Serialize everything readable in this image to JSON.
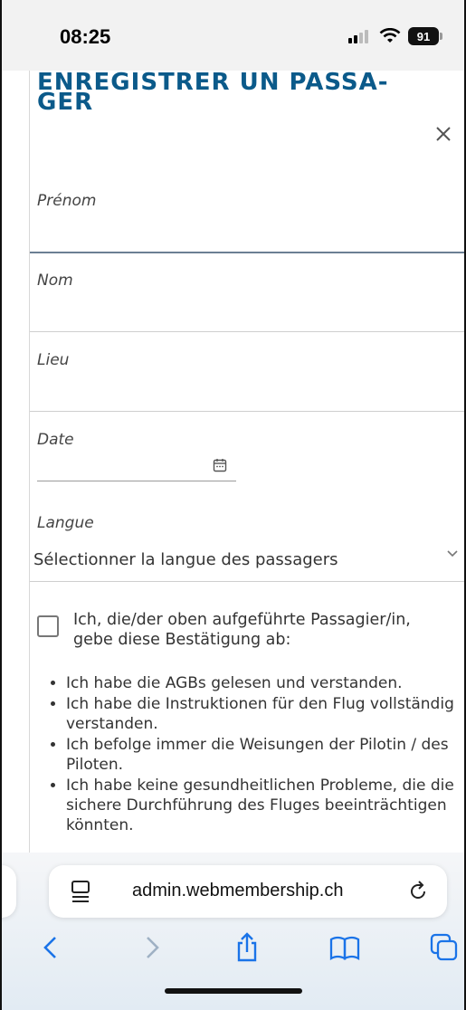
{
  "status_bar": {
    "time": "08:25",
    "battery": "91",
    "icons": [
      "signal-icon",
      "wifi-icon",
      "battery-icon"
    ]
  },
  "form": {
    "title": "ENREGISTRER UN PASSA-GER",
    "close_icon": "close-icon",
    "fields": {
      "first_name": {
        "label": "Prénom",
        "value": ""
      },
      "last_name": {
        "label": "Nom",
        "value": ""
      },
      "place": {
        "label": "Lieu",
        "value": ""
      },
      "date": {
        "label": "Date",
        "value": ""
      },
      "language": {
        "label": "Langue",
        "selected": "Sélectionner la langue des passagers"
      }
    },
    "consent": {
      "checked": false,
      "text": "Ich, die/der oben aufgeführte Passagier/in, gebe diese Bestätigung ab:",
      "bullets": [
        "Ich habe die AGBs gelesen und verstanden.",
        "Ich habe die Instruktionen für den Flug vollständig verstanden.",
        "Ich befolge immer die Weisungen der Pilotin / des Piloten.",
        "Ich habe keine gesundheitlichen Probleme, die die sichere Durchführung des Fluges beeinträchtigen könnten."
      ]
    }
  },
  "browser": {
    "url": "admin.webmembership.ch",
    "buttons": [
      "back-icon",
      "forward-icon",
      "share-icon",
      "bookmarks-icon",
      "tabs-icon"
    ]
  },
  "colors": {
    "title": "#0b5a8a",
    "focus_line": "#6b7f93",
    "browser_accent": "#1a73e8"
  }
}
